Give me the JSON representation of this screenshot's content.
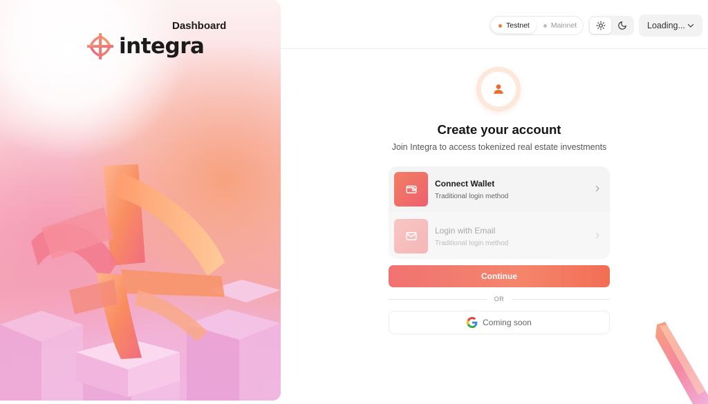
{
  "header": {
    "title": "Dashboard",
    "network": [
      {
        "label": "Testnet",
        "active": true
      },
      {
        "label": "Mainnet",
        "active": false
      }
    ],
    "theme": {
      "light_icon": "sun-icon",
      "dark_icon": "moon-icon",
      "active": "light"
    },
    "account_label": "Loading..."
  },
  "hero": {
    "logo_text": "integra",
    "logo_icon": "integra-logo-icon"
  },
  "auth": {
    "avatar_icon": "user-icon",
    "title": "Create your account",
    "subtitle": "Join Integra to access tokenized real estate investments",
    "methods": [
      {
        "label": "Connect Wallet",
        "description": "Traditional login method",
        "icon": "wallet-icon",
        "enabled": true
      },
      {
        "label": "Login with Email",
        "description": "Traditional login method",
        "icon": "mail-icon",
        "enabled": false
      }
    ],
    "continue_label": "Continue",
    "divider_text": "OR",
    "google_label": "Coming soon",
    "google_icon": "google-icon"
  },
  "colors": {
    "accent": "#f17272",
    "accent_orange": "#f07a3a"
  }
}
